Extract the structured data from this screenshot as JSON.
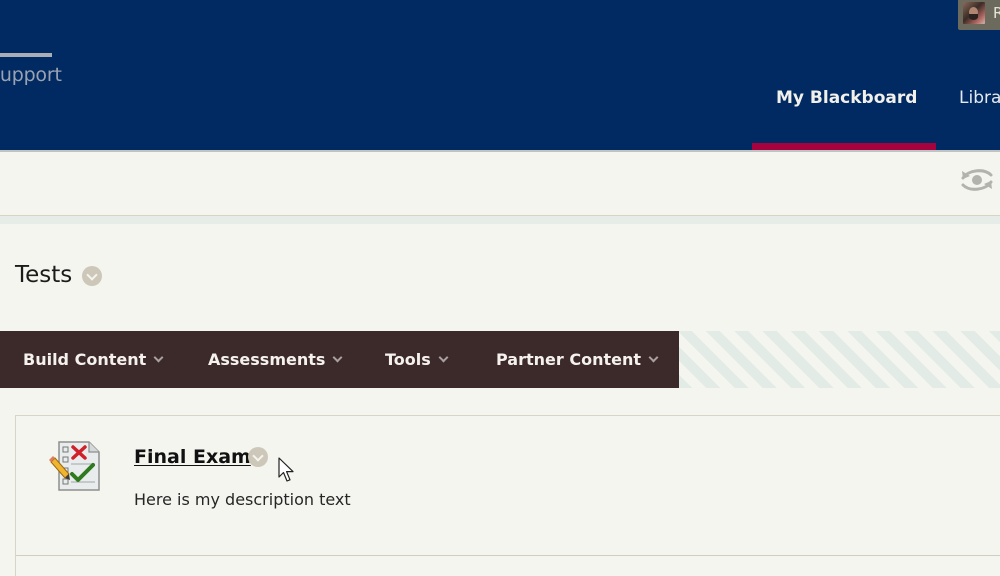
{
  "header": {
    "support_link": "Support",
    "user_initial": "R",
    "tabs": [
      {
        "label": "My Blackboard",
        "active": true
      },
      {
        "label": "Libraries",
        "active": false
      }
    ],
    "colors": {
      "header_bg": "#012a62",
      "active_tab_indicator": "#a6023d"
    }
  },
  "subbar": {
    "edit_mode_icon": "eye-refresh-icon"
  },
  "page": {
    "title": "Tests"
  },
  "action_bar": {
    "items": [
      {
        "label": "Build Content"
      },
      {
        "label": "Assessments"
      },
      {
        "label": "Tools"
      },
      {
        "label": "Partner Content"
      }
    ],
    "bg_color": "#3c2a2b"
  },
  "content": {
    "items": [
      {
        "title": "Final Exam",
        "description": "Here is my description text",
        "icon": "test-icon"
      }
    ]
  }
}
